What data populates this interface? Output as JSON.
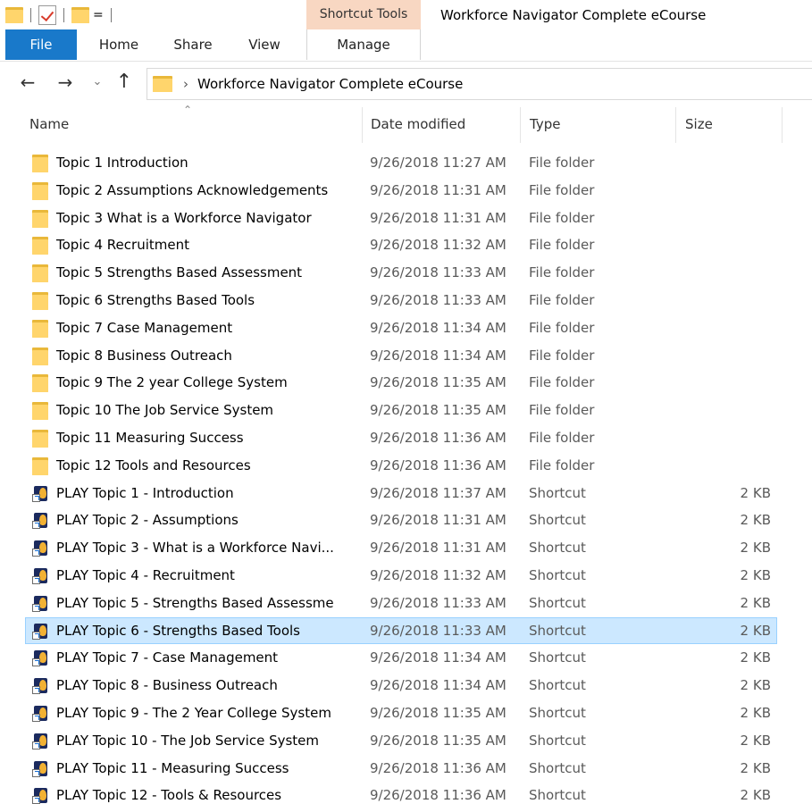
{
  "titlebar": {
    "contextual_header": "Shortcut Tools",
    "window_title": "Workforce Navigator Complete eCourse",
    "qat_dropdown": "="
  },
  "ribbon": {
    "tabs": [
      {
        "label": "File",
        "active": true
      },
      {
        "label": "Home"
      },
      {
        "label": "Share"
      },
      {
        "label": "View"
      },
      {
        "label": "Manage"
      }
    ]
  },
  "address": {
    "path": "Workforce Navigator Complete eCourse"
  },
  "columns": {
    "name": "Name",
    "date": "Date modified",
    "type": "Type",
    "size": "Size"
  },
  "files": [
    {
      "name": "Topic 1 Introduction",
      "date": "9/26/2018 11:27 AM",
      "type": "File folder",
      "size": "",
      "icon": "folder-icon"
    },
    {
      "name": "Topic 2 Assumptions Acknowledgements",
      "date": "9/26/2018 11:31 AM",
      "type": "File folder",
      "size": "",
      "icon": "folder-icon"
    },
    {
      "name": "Topic 3 What is a Workforce Navigator",
      "date": "9/26/2018 11:31 AM",
      "type": "File folder",
      "size": "",
      "icon": "folder-icon"
    },
    {
      "name": "Topic 4 Recruitment",
      "date": "9/26/2018 11:32 AM",
      "type": "File folder",
      "size": "",
      "icon": "folder-icon"
    },
    {
      "name": "Topic 5 Strengths Based Assessment",
      "date": "9/26/2018 11:33 AM",
      "type": "File folder",
      "size": "",
      "icon": "folder-icon"
    },
    {
      "name": "Topic 6 Strengths Based Tools",
      "date": "9/26/2018 11:33 AM",
      "type": "File folder",
      "size": "",
      "icon": "folder-icon"
    },
    {
      "name": "Topic 7 Case Management",
      "date": "9/26/2018 11:34 AM",
      "type": "File folder",
      "size": "",
      "icon": "folder-icon"
    },
    {
      "name": "Topic 8 Business Outreach",
      "date": "9/26/2018 11:34 AM",
      "type": "File folder",
      "size": "",
      "icon": "folder-icon"
    },
    {
      "name": "Topic 9 The 2 year College System",
      "date": "9/26/2018 11:35 AM",
      "type": "File folder",
      "size": "",
      "icon": "folder-icon"
    },
    {
      "name": "Topic 10 The Job Service System",
      "date": "9/26/2018 11:35 AM",
      "type": "File folder",
      "size": "",
      "icon": "folder-icon"
    },
    {
      "name": "Topic 11 Measuring Success",
      "date": "9/26/2018 11:36 AM",
      "type": "File folder",
      "size": "",
      "icon": "folder-icon"
    },
    {
      "name": "Topic 12 Tools and Resources",
      "date": "9/26/2018 11:36 AM",
      "type": "File folder",
      "size": "",
      "icon": "folder-icon"
    },
    {
      "name": "PLAY Topic 1 - Introduction",
      "date": "9/26/2018 11:37 AM",
      "type": "Shortcut",
      "size": "2 KB",
      "icon": "shortcut-icon"
    },
    {
      "name": "PLAY Topic 2 - Assumptions",
      "date": "9/26/2018 11:31 AM",
      "type": "Shortcut",
      "size": "2 KB",
      "icon": "shortcut-icon"
    },
    {
      "name": "PLAY Topic 3 - What is a Workforce Navi...",
      "date": "9/26/2018 11:31 AM",
      "type": "Shortcut",
      "size": "2 KB",
      "icon": "shortcut-icon"
    },
    {
      "name": "PLAY Topic 4 - Recruitment",
      "date": "9/26/2018 11:32 AM",
      "type": "Shortcut",
      "size": "2 KB",
      "icon": "shortcut-icon"
    },
    {
      "name": "PLAY Topic 5 - Strengths Based Assessme",
      "date": "9/26/2018 11:33 AM",
      "type": "Shortcut",
      "size": "2 KB",
      "icon": "shortcut-icon"
    },
    {
      "name": "PLAY Topic 6 - Strengths Based Tools",
      "date": "9/26/2018 11:33 AM",
      "type": "Shortcut",
      "size": "2 KB",
      "icon": "shortcut-icon",
      "selected": true
    },
    {
      "name": "PLAY Topic 7 - Case Management",
      "date": "9/26/2018 11:34 AM",
      "type": "Shortcut",
      "size": "2 KB",
      "icon": "shortcut-icon"
    },
    {
      "name": "PLAY Topic 8 - Business Outreach",
      "date": "9/26/2018 11:34 AM",
      "type": "Shortcut",
      "size": "2 KB",
      "icon": "shortcut-icon"
    },
    {
      "name": "PLAY Topic 9 - The 2 Year College System",
      "date": "9/26/2018 11:35 AM",
      "type": "Shortcut",
      "size": "2 KB",
      "icon": "shortcut-icon"
    },
    {
      "name": "PLAY Topic 10 - The Job Service System",
      "date": "9/26/2018 11:35 AM",
      "type": "Shortcut",
      "size": "2 KB",
      "icon": "shortcut-icon"
    },
    {
      "name": "PLAY Topic 11 - Measuring Success",
      "date": "9/26/2018 11:36 AM",
      "type": "Shortcut",
      "size": "2 KB",
      "icon": "shortcut-icon"
    },
    {
      "name": "PLAY Topic 12 - Tools & Resources",
      "date": "9/26/2018 11:36 AM",
      "type": "Shortcut",
      "size": "2 KB",
      "icon": "shortcut-icon"
    }
  ],
  "colors": {
    "file_tab": "#1979ca",
    "contextual_tab": "#f8d7c2",
    "selection_fill": "#cce8ff",
    "selection_border": "#99d1ff",
    "folder_yellow": "#ffd56c"
  }
}
